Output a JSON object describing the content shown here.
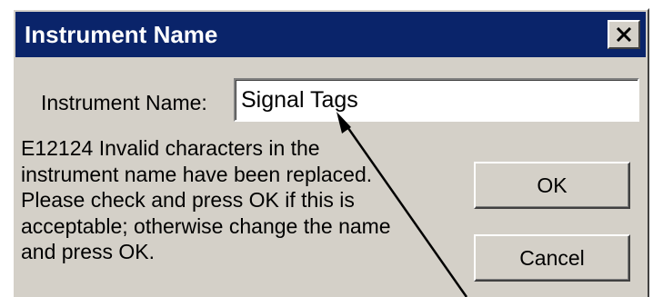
{
  "dialog": {
    "title": "Instrument Name",
    "close_icon": "close-icon",
    "field_label": "Instrument Name:",
    "field_value": "Signal Tags",
    "message": "E12124 Invalid characters in the\ninstrument name have been replaced.\nPlease check and press OK if this is\nacceptable; otherwise change the name\nand press OK.",
    "ok_label": "OK",
    "cancel_label": "Cancel"
  },
  "annotation": {
    "icon": "arrow-icon"
  },
  "colors": {
    "titlebar": "#0a246a",
    "dialog_face": "#d4d0c8",
    "title_text": "#ffffff"
  }
}
